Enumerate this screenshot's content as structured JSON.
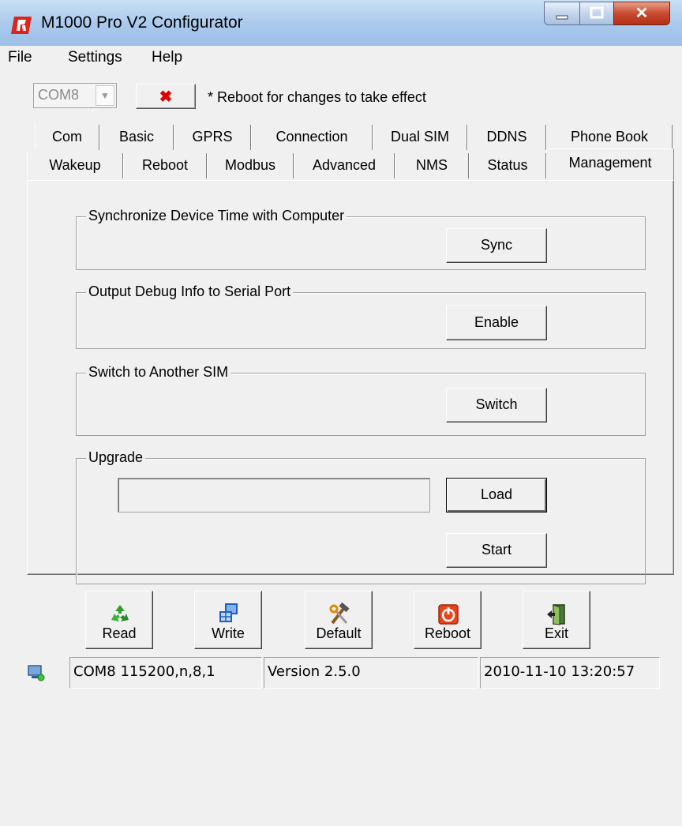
{
  "window": {
    "title": "M1000 Pro V2 Configurator"
  },
  "menu": [
    "File",
    "Settings",
    "Help"
  ],
  "toolbar": {
    "com_port": "COM8",
    "disconnect_symbol": "✖",
    "note": "* Reboot for changes to take effect"
  },
  "tabs": {
    "row1": [
      "Com",
      "Basic",
      "GPRS",
      "Connection",
      "Dual SIM",
      "DDNS",
      "Phone Book"
    ],
    "row2": [
      "Wakeup",
      "Reboot",
      "Modbus",
      "Advanced",
      "NMS",
      "Status",
      "Management"
    ],
    "active": "Management"
  },
  "groups": {
    "sync": {
      "title": "Synchronize Device Time with Computer",
      "button": "Sync"
    },
    "debug": {
      "title": "Output Debug Info to Serial Port",
      "button": "Enable"
    },
    "sim": {
      "title": "Switch to Another SIM",
      "button": "Switch"
    },
    "upgrade": {
      "title": "Upgrade",
      "path": "",
      "load": "Load",
      "start": "Start"
    }
  },
  "actions": [
    "Read",
    "Write",
    "Default",
    "Reboot",
    "Exit"
  ],
  "status": {
    "port": "COM8 115200,n,8,1",
    "version": "Version 2.5.0",
    "datetime": "2010-11-10 13:20:57"
  },
  "colors": {
    "titlebar": "#a9c8ec",
    "close": "#c94a30",
    "disconnect": "#e00000"
  }
}
